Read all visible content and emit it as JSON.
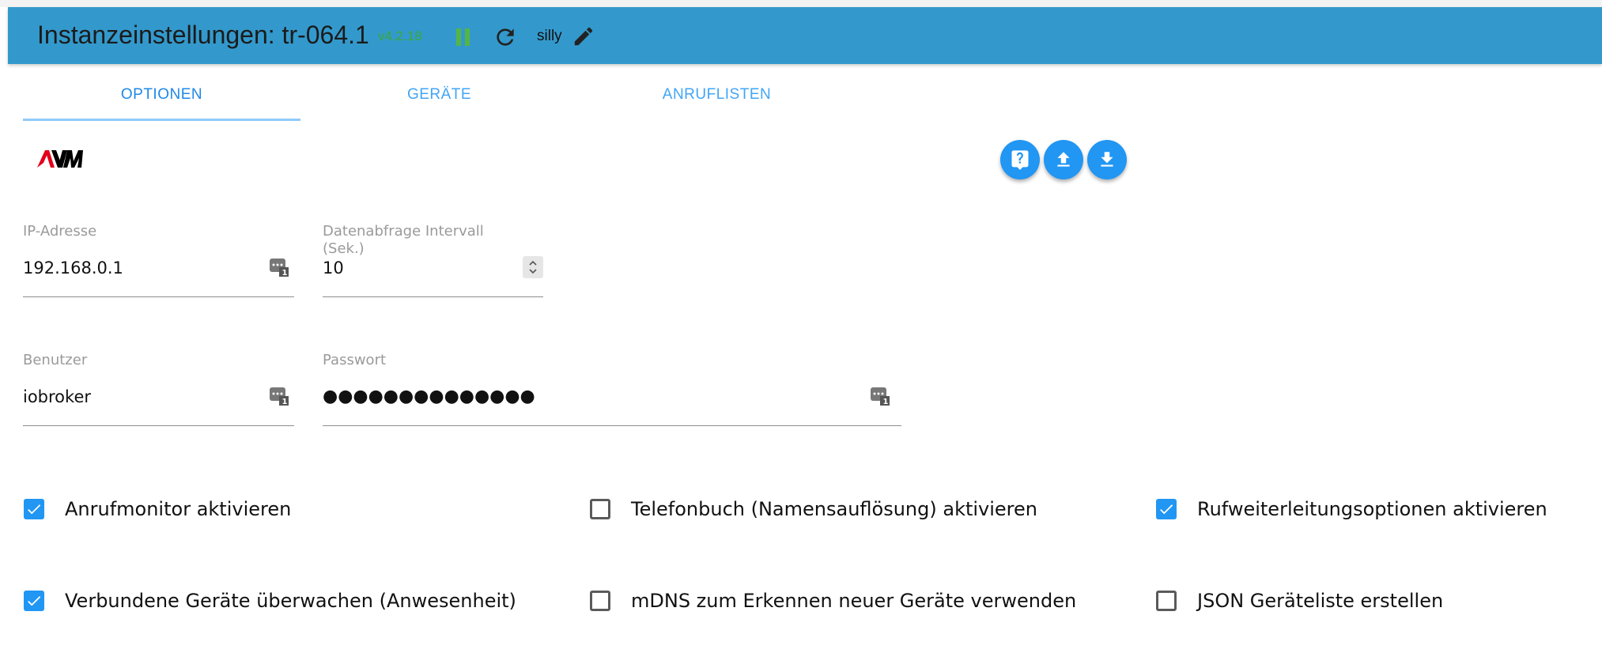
{
  "header": {
    "title": "Instanzeinstellungen: tr-064.1",
    "version": "v4.2.18",
    "mode": "silly",
    "icons": [
      "pause-icon",
      "reload-icon",
      "edit-icon"
    ],
    "colors": {
      "bar": "#3399cc",
      "version": "#3aa83a",
      "pause": "#55b544"
    }
  },
  "tabs": [
    {
      "label": "OPTIONEN",
      "active": true
    },
    {
      "label": "GERÄTE",
      "active": false
    },
    {
      "label": "ANRUFLISTEN",
      "active": false
    }
  ],
  "toolbar": {
    "logo": "AVM",
    "buttons": [
      "help-icon",
      "upload-icon",
      "download-icon"
    ],
    "color": "#2196f3"
  },
  "form": {
    "ip": {
      "label": "IP-Adresse",
      "value": "192.168.0.1"
    },
    "interval": {
      "label_line1": "Datenabfrage Intervall",
      "label_line2": "(Sek.)",
      "value": "10"
    },
    "user": {
      "label": "Benutzer",
      "value": "iobroker"
    },
    "password": {
      "label": "Passwort",
      "value": "●●●●●●●●●●●●●●"
    }
  },
  "options": [
    {
      "label": "Anrufmonitor aktivieren",
      "checked": true
    },
    {
      "label": "Telefonbuch (Namensauflösung) aktivieren",
      "checked": false
    },
    {
      "label": "Rufweiterleitungsoptionen aktivieren",
      "checked": true
    },
    {
      "label": "Verbundene Geräte überwachen (Anwesenheit)",
      "checked": true
    },
    {
      "label": "mDNS zum Erkennen neuer Geräte verwenden",
      "checked": false
    },
    {
      "label": "JSON Geräteliste erstellen",
      "checked": false
    }
  ]
}
